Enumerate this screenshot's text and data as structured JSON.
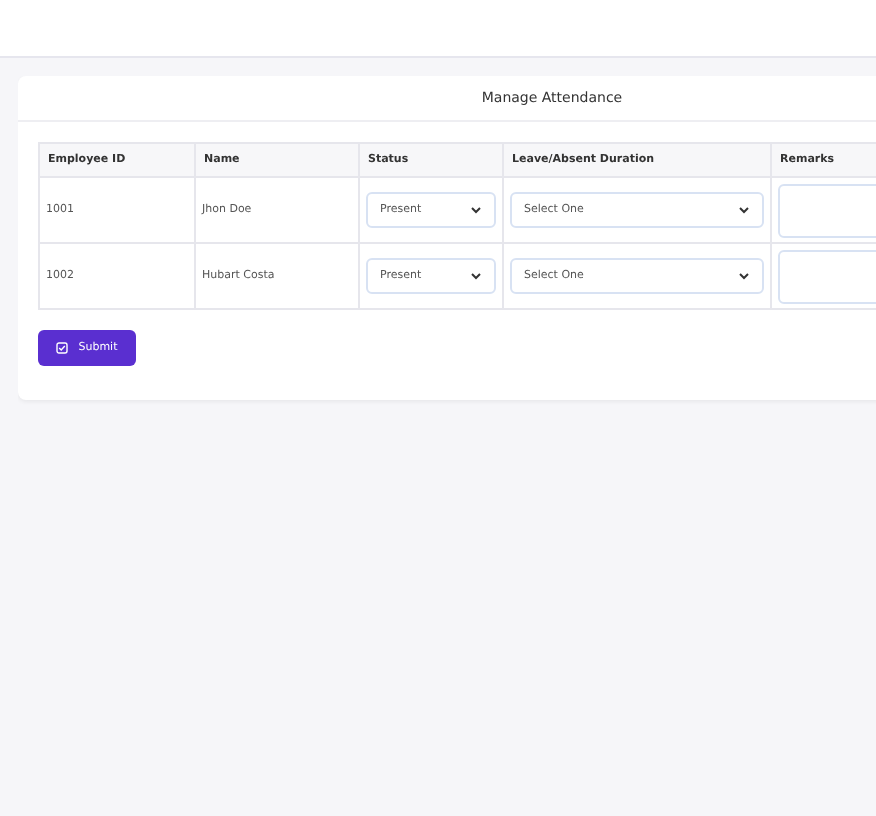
{
  "card": {
    "title": "Manage Attendance"
  },
  "table": {
    "columns": [
      "Employee ID",
      "Name",
      "Status",
      "Leave/Absent Duration",
      "Remarks"
    ],
    "rows": [
      {
        "id": "1001",
        "name": "Jhon Doe",
        "status": "Present",
        "duration": "Select One"
      },
      {
        "id": "1002",
        "name": "Hubart Costa",
        "status": "Present",
        "duration": "Select One"
      }
    ]
  },
  "submit": {
    "label": "Submit"
  }
}
